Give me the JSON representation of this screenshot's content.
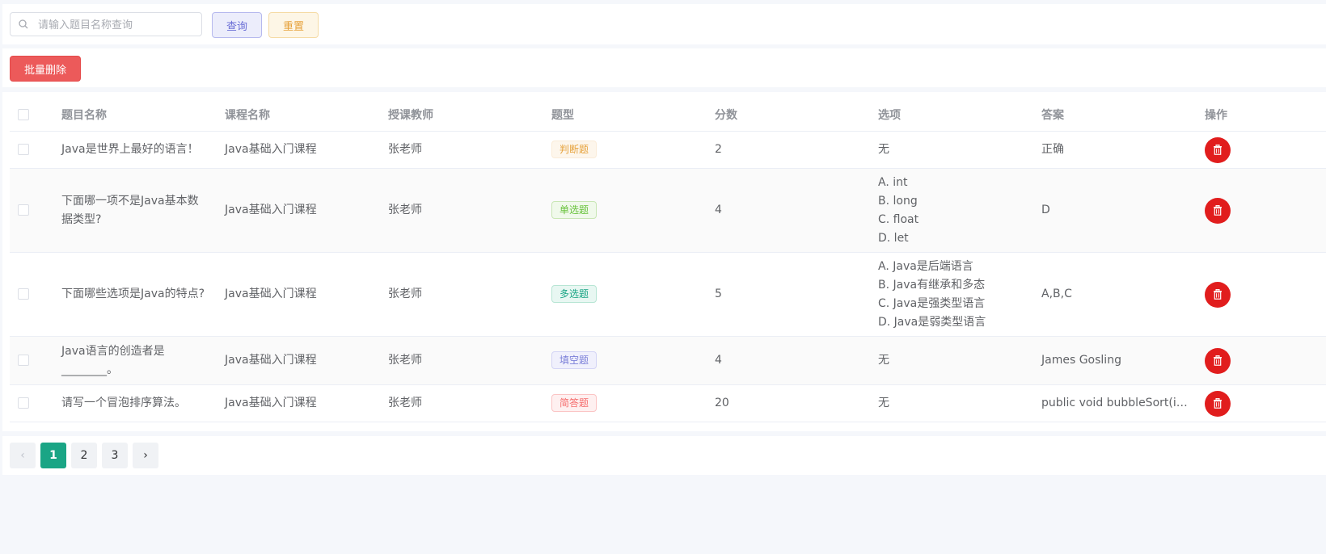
{
  "search": {
    "placeholder": "请输入题目名称查询",
    "value": ""
  },
  "buttons": {
    "query": "查询",
    "reset": "重置",
    "batch_delete": "批量删除"
  },
  "table": {
    "headers": [
      "题目名称",
      "课程名称",
      "授课教师",
      "题型",
      "分数",
      "选项",
      "答案",
      "操作"
    ],
    "rows": [
      {
        "name": "Java是世界上最好的语言！",
        "course": "Java基础入门课程",
        "teacher": "张老师",
        "type": "判断题",
        "score": "2",
        "options": [
          "无"
        ],
        "answer": "正确"
      },
      {
        "name": "下面哪一项不是Java基本数据类型?",
        "course": "Java基础入门课程",
        "teacher": "张老师",
        "type": "单选题",
        "score": "4",
        "options": [
          "A. int",
          "B. long",
          "C. float",
          "D. let"
        ],
        "answer": "D"
      },
      {
        "name": "下面哪些选项是Java的特点?",
        "course": "Java基础入门课程",
        "teacher": "张老师",
        "type": "多选题",
        "score": "5",
        "options": [
          "A. Java是后端语言",
          "B. Java有继承和多态",
          "C. Java是强类型语言",
          "D. Java是弱类型语言"
        ],
        "answer": "A,B,C"
      },
      {
        "name": "Java语言的创造者是________。",
        "course": "Java基础入门课程",
        "teacher": "张老师",
        "type": "填空题",
        "score": "4",
        "options": [
          "无"
        ],
        "answer": "James Gosling"
      },
      {
        "name": "请写一个冒泡排序算法。",
        "course": "Java基础入门课程",
        "teacher": "张老师",
        "type": "简答题",
        "score": "20",
        "options": [
          "无"
        ],
        "answer": "public void bubbleSort(in…"
      }
    ]
  },
  "tag_colors": {
    "判断题": {
      "bg": "#fdf6ec",
      "border": "#faecd8",
      "text": "#e6a23c"
    },
    "单选题": {
      "bg": "#f0f9eb",
      "border": "#c8e6b4",
      "text": "#67c23a"
    },
    "多选题": {
      "bg": "#e8f7f2",
      "border": "#b7e5d4",
      "text": "#1aa585"
    },
    "填空题": {
      "bg": "#f0f0fc",
      "border": "#d3d4f5",
      "text": "#7b7fd8"
    },
    "简答题": {
      "bg": "#fef0f0",
      "border": "#fbc4c4",
      "text": "#f56c6c"
    }
  },
  "pagination": {
    "pages": [
      "1",
      "2",
      "3"
    ],
    "current": "1",
    "prev": "‹",
    "next": "›"
  }
}
